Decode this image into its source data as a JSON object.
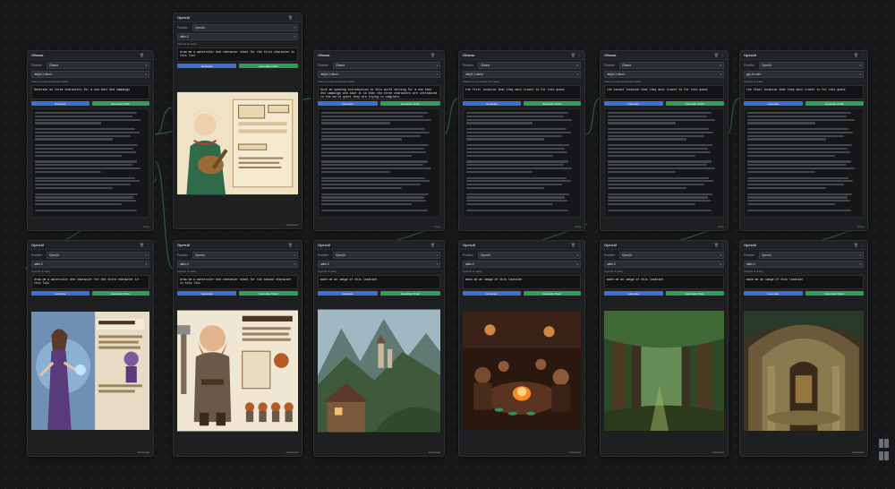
{
  "labels": {
    "provider": "Provider",
    "ready": "OpenAI is ready",
    "ready_ollama": "Ollama is connected and ready",
    "generate": "Generate",
    "generate_chain": "Generate Chain",
    "copy": "Copy",
    "download": "Download"
  },
  "nodes_top": [
    {
      "title": "Ollama",
      "provider": "Ollama",
      "model": "dolly3.2-latest",
      "prompt": "Generate an three characters for a one-shot dnd campaign"
    },
    {
      "title": "OpenAI",
      "provider": "OpenAI",
      "model": "dalle-3",
      "prompt": "draw me a watercolor dnd character sheet for the first character in this list"
    },
    {
      "title": "Ollama",
      "provider": "Ollama",
      "model": "dolly3.2-latest",
      "prompt": "Give an opening introduction to this world setting for a one shot dnd campaign and take it so that the three characters are introduced to the world quest they are trying to complete."
    },
    {
      "title": "Ollama",
      "provider": "Ollama",
      "model": "dolly3.2-latest",
      "prompt": "the first location that they must travel to for this quest"
    },
    {
      "title": "Ollama",
      "provider": "Ollama",
      "model": "dolly3.2-latest",
      "prompt": "the second location that they must travel to for this quest"
    },
    {
      "title": "OpenAI",
      "provider": "OpenAI",
      "model": "gpt-4o-mini",
      "prompt": "the final location that they must travel to for this quest"
    }
  ],
  "nodes_bottom": [
    {
      "title": "OpenAI",
      "provider": "OpenAI",
      "model": "dalle-3",
      "prompt": "draw me a watercolor dnd character for the third character in this list"
    },
    {
      "title": "OpenAI",
      "provider": "OpenAI",
      "model": "dalle-3",
      "prompt": "draw me a watercolor dnd character sheet for the second character in this list"
    },
    {
      "title": "OpenAI",
      "provider": "OpenAI",
      "model": "dalle-3",
      "prompt": "make me an image of this location"
    },
    {
      "title": "OpenAI",
      "provider": "OpenAI",
      "model": "dalle-3",
      "prompt": "make me an image of this location"
    },
    {
      "title": "OpenAI",
      "provider": "OpenAI",
      "model": "dalle-3",
      "prompt": "make me an image of this location"
    },
    {
      "title": "OpenAI",
      "provider": "OpenAI",
      "model": "dalle-3",
      "prompt": "make me an image of this location"
    }
  ],
  "icons": {
    "menu": "menu-icon",
    "trash": "trash-icon",
    "download": "download-icon"
  },
  "colors": {
    "generate": "#3d6fd6",
    "generate_chain": "#2f9e58",
    "wire": "#2d6b3f"
  }
}
